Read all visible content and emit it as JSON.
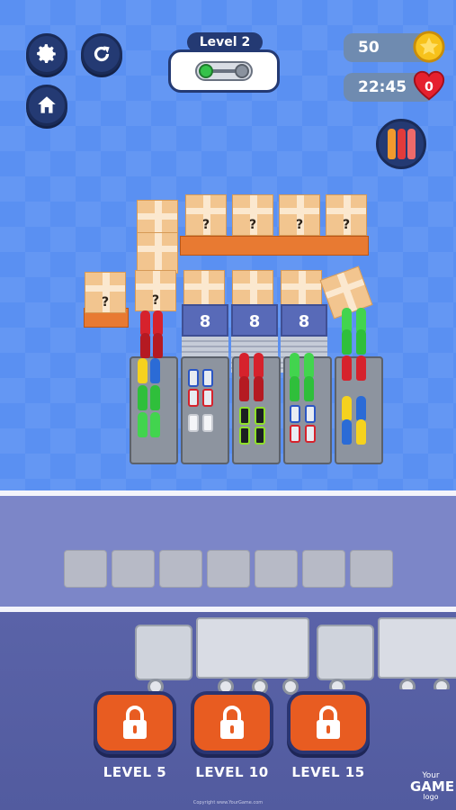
{
  "header": {
    "level_title": "Level 2",
    "level_progress": 0.0,
    "coins": "50",
    "timer": "22:45",
    "lives": "0"
  },
  "board": {
    "shelf_counts": [
      "8",
      "8",
      "8"
    ],
    "unknown_mark": "?"
  },
  "slots": {
    "count": 7
  },
  "levels": [
    {
      "label": "LEVEL 5",
      "locked": true
    },
    {
      "label": "LEVEL 10",
      "locked": true
    },
    {
      "label": "LEVEL 15",
      "locked": true
    }
  ],
  "logo": {
    "line1": "Your",
    "line2": "GAME",
    "line3": "logo"
  },
  "footer": {
    "copyright": "Copyright www.YourGame.com"
  },
  "colors": {
    "background": "#5a90f2",
    "button_dark": "#243a73",
    "lock_orange": "#e85c21",
    "crate": "#f2c58f",
    "crate_base": "#e87a32"
  },
  "icons": [
    "gear-icon",
    "restart-icon",
    "home-icon",
    "coin-star-icon",
    "heart-icon",
    "bottles-icon",
    "lock-icon"
  ]
}
